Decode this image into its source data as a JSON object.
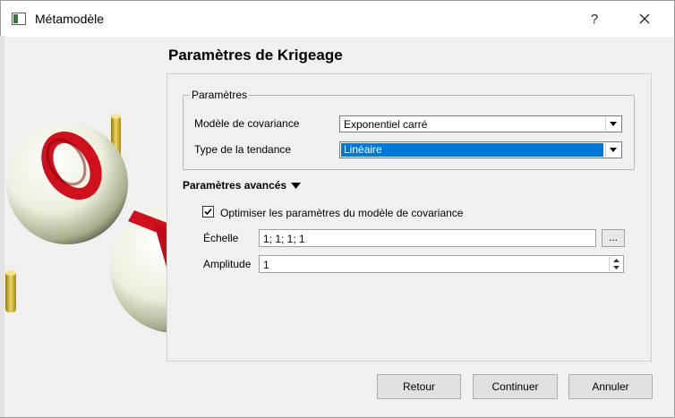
{
  "window": {
    "title": "Métamodèle",
    "help_label": "?"
  },
  "page": {
    "title": "Paramètres de Krigeage"
  },
  "parameters_group": {
    "title": "Paramètres",
    "covariance_label": "Modèle de covariance",
    "covariance_value": "Exponentiel carré",
    "trend_label": "Type de la tendance",
    "trend_value": "Linéaire"
  },
  "advanced": {
    "title": "Paramètres avancés",
    "optimize_label": "Optimiser les paramètres du modèle de covariance",
    "optimize_checked": true,
    "scale_label": "Échelle",
    "scale_value": "1; 1; 1; 1",
    "scale_button_label": "...",
    "amplitude_label": "Amplitude",
    "amplitude_value": "1"
  },
  "buttons": {
    "back": "Retour",
    "continue": "Continuer",
    "cancel": "Annuler"
  },
  "colors": {
    "selection": "#0078d7",
    "logo_red": "#d0101c",
    "logo_yellow": "#e0c23a"
  }
}
